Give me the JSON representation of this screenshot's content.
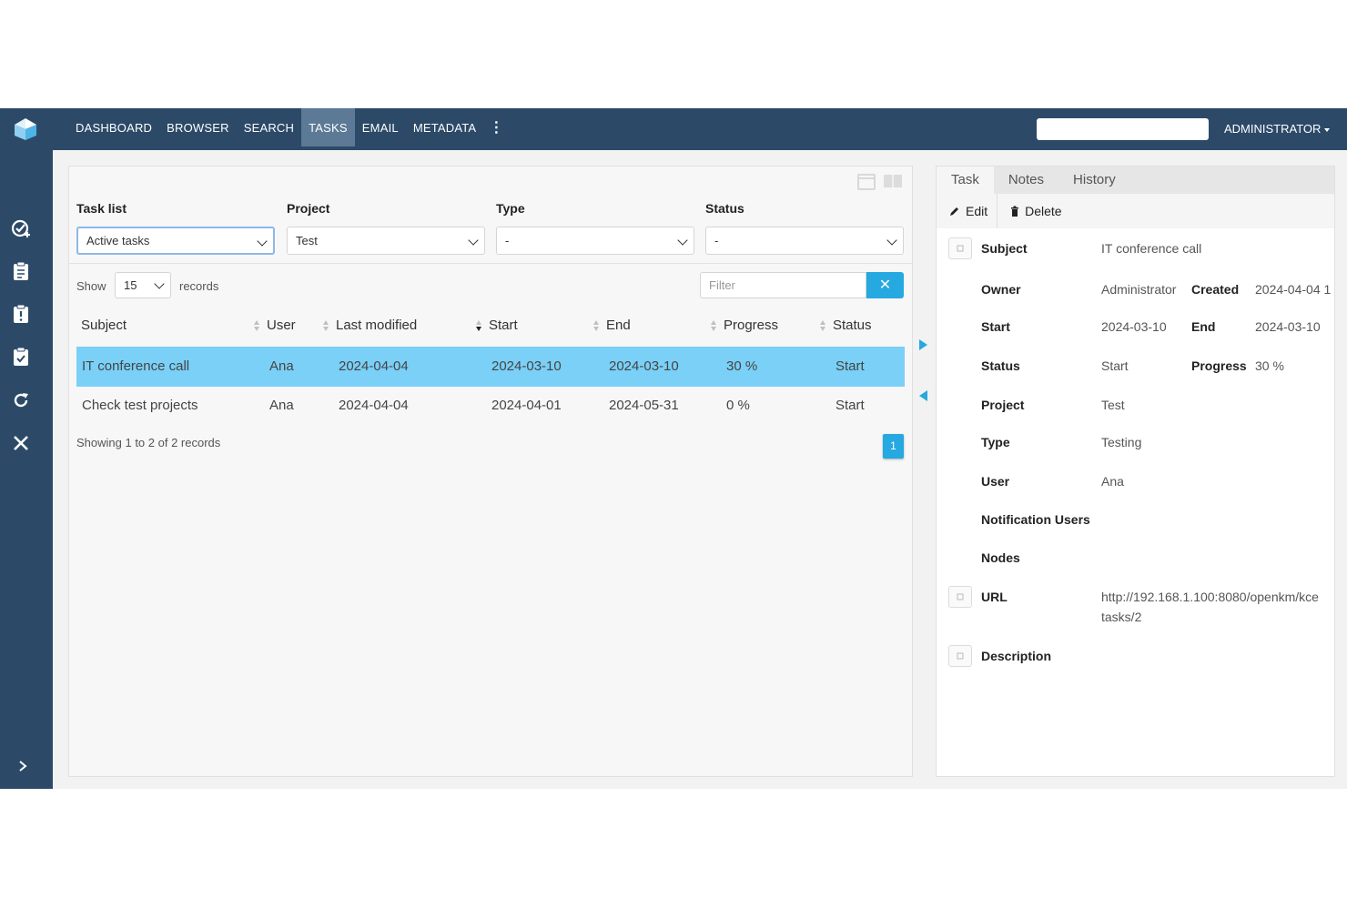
{
  "topbar": {
    "nav": [
      "DASHBOARD",
      "BROWSER",
      "SEARCH",
      "TASKS",
      "EMAIL",
      "METADATA"
    ],
    "active_nav": "TASKS",
    "search_placeholder": "",
    "user": "ADMINISTRATOR"
  },
  "sidebar": {
    "icons": [
      "task-add-icon",
      "clipboard-icon",
      "clipboard-alert-icon",
      "clipboard-check-icon",
      "refresh-icon",
      "close-icon",
      "chevron-right-icon"
    ]
  },
  "filters": {
    "task_list_label": "Task list",
    "task_list_value": "Active tasks",
    "project_label": "Project",
    "project_value": "Test",
    "type_label": "Type",
    "type_value": "-",
    "status_label": "Status",
    "status_value": "-"
  },
  "table_controls": {
    "show_label": "Show",
    "page_size": "15",
    "records_label": "records",
    "filter_placeholder": "Filter"
  },
  "table": {
    "columns": [
      "Subject",
      "User",
      "Last modified",
      "Start",
      "End",
      "Progress",
      "Status"
    ],
    "rows": [
      {
        "subject": "IT conference call",
        "user": "Ana",
        "last_modified": "2024-04-04",
        "start": "2024-03-10",
        "end": "2024-03-10",
        "progress": "30 %",
        "status": "Start"
      },
      {
        "subject": "Check test projects",
        "user": "Ana",
        "last_modified": "2024-04-04",
        "start": "2024-04-01",
        "end": "2024-05-31",
        "progress": "0 %",
        "status": "Start"
      }
    ],
    "showing": "Showing 1 to 2 of 2 records",
    "current_page": "1"
  },
  "detail": {
    "tabs": [
      "Task",
      "Notes",
      "History"
    ],
    "active_tab": "Task",
    "edit_label": "Edit",
    "delete_label": "Delete",
    "fields": {
      "subject_label": "Subject",
      "subject": "IT conference call",
      "owner_label": "Owner",
      "owner": "Administrator",
      "created_label": "Created",
      "created": "2024-04-04 1",
      "start_label": "Start",
      "start": "2024-03-10",
      "end_label": "End",
      "end": "2024-03-10",
      "status_label": "Status",
      "status": "Start",
      "progress_label": "Progress",
      "progress": "30 %",
      "project_label": "Project",
      "project": "Test",
      "type_label": "Type",
      "type": "Testing",
      "user_label": "User",
      "user": "Ana",
      "notification_users_label": "Notification Users",
      "nodes_label": "Nodes",
      "url_label": "URL",
      "url": "http://192.168.1.100:8080/openkm/kce",
      "url_line2": "tasks/2",
      "description_label": "Description"
    }
  },
  "colors": {
    "topbar": "#2c4a68",
    "active_nav": "#5c7a96",
    "accent": "#26a8e0",
    "selected_row": "#7ad0f7"
  }
}
